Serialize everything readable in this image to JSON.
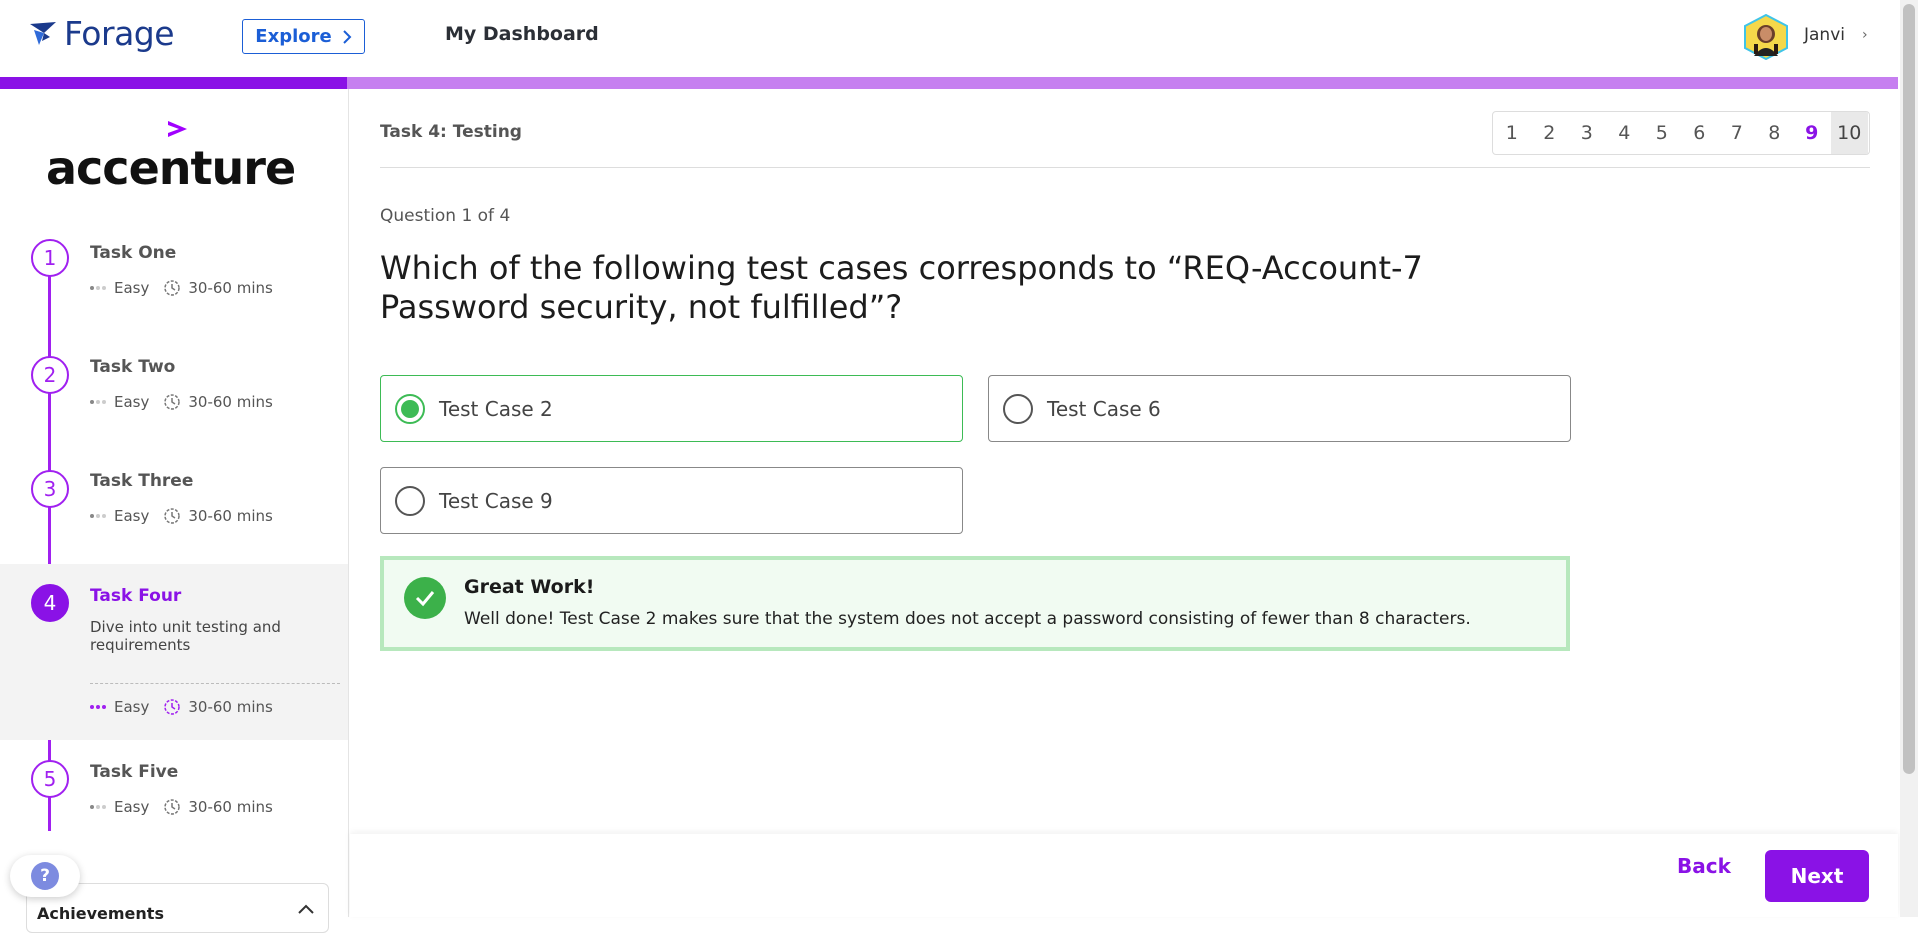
{
  "header": {
    "logo_text": "Forage",
    "explore_label": "Explore",
    "dashboard_label": "My Dashboard",
    "user_name": "Janvi"
  },
  "progress": {
    "fraction": 0.183,
    "fill_color": "#8a12e6",
    "track_color": "#c67ff0"
  },
  "sidebar": {
    "company_logo_text": "accenture",
    "tasks": [
      {
        "number": "1",
        "title": "Task One",
        "difficulty": "Easy",
        "duration": "30-60 mins",
        "active": false,
        "description": ""
      },
      {
        "number": "2",
        "title": "Task Two",
        "difficulty": "Easy",
        "duration": "30-60 mins",
        "active": false,
        "description": ""
      },
      {
        "number": "3",
        "title": "Task Three",
        "difficulty": "Easy",
        "duration": "30-60 mins",
        "active": false,
        "description": ""
      },
      {
        "number": "4",
        "title": "Task Four",
        "difficulty": "Easy",
        "duration": "30-60 mins",
        "active": true,
        "description": "Dive into unit testing and requirements"
      },
      {
        "number": "5",
        "title": "Task Five",
        "difficulty": "Easy",
        "duration": "30-60 mins",
        "active": false,
        "description": ""
      }
    ],
    "help_label": "?",
    "achievements_label": "Achievements"
  },
  "main": {
    "task_label": "Task 4: Testing",
    "question_nav": [
      "1",
      "2",
      "3",
      "4",
      "5",
      "6",
      "7",
      "8",
      "9",
      "10"
    ],
    "question_nav_done": "9",
    "question_nav_current": "10",
    "question_count": "Question 1 of 4",
    "question_text": "Which of the following test cases corresponds to “REQ-Account-7 Password security, not fulfilled”?",
    "options": [
      {
        "label": "Test Case 2",
        "selected": true
      },
      {
        "label": "Test Case 6",
        "selected": false
      },
      {
        "label": "Test Case 9",
        "selected": false
      }
    ],
    "feedback": {
      "title": "Great Work!",
      "body": "Well done! Test Case 2 makes sure that the system does not accept a password consisting of fewer than 8 characters."
    }
  },
  "footer": {
    "back_label": "Back",
    "next_label": "Next"
  },
  "colors": {
    "accent": "#8a12e6",
    "success": "#3cb14a",
    "brand_blue": "#1b3a8c"
  },
  "icons": [
    "forage-logo-icon",
    "chevron-right-icon",
    "avatar",
    "clock-icon",
    "check-icon",
    "help-icon",
    "chevron-up-icon",
    "accenture-arrow-icon"
  ]
}
